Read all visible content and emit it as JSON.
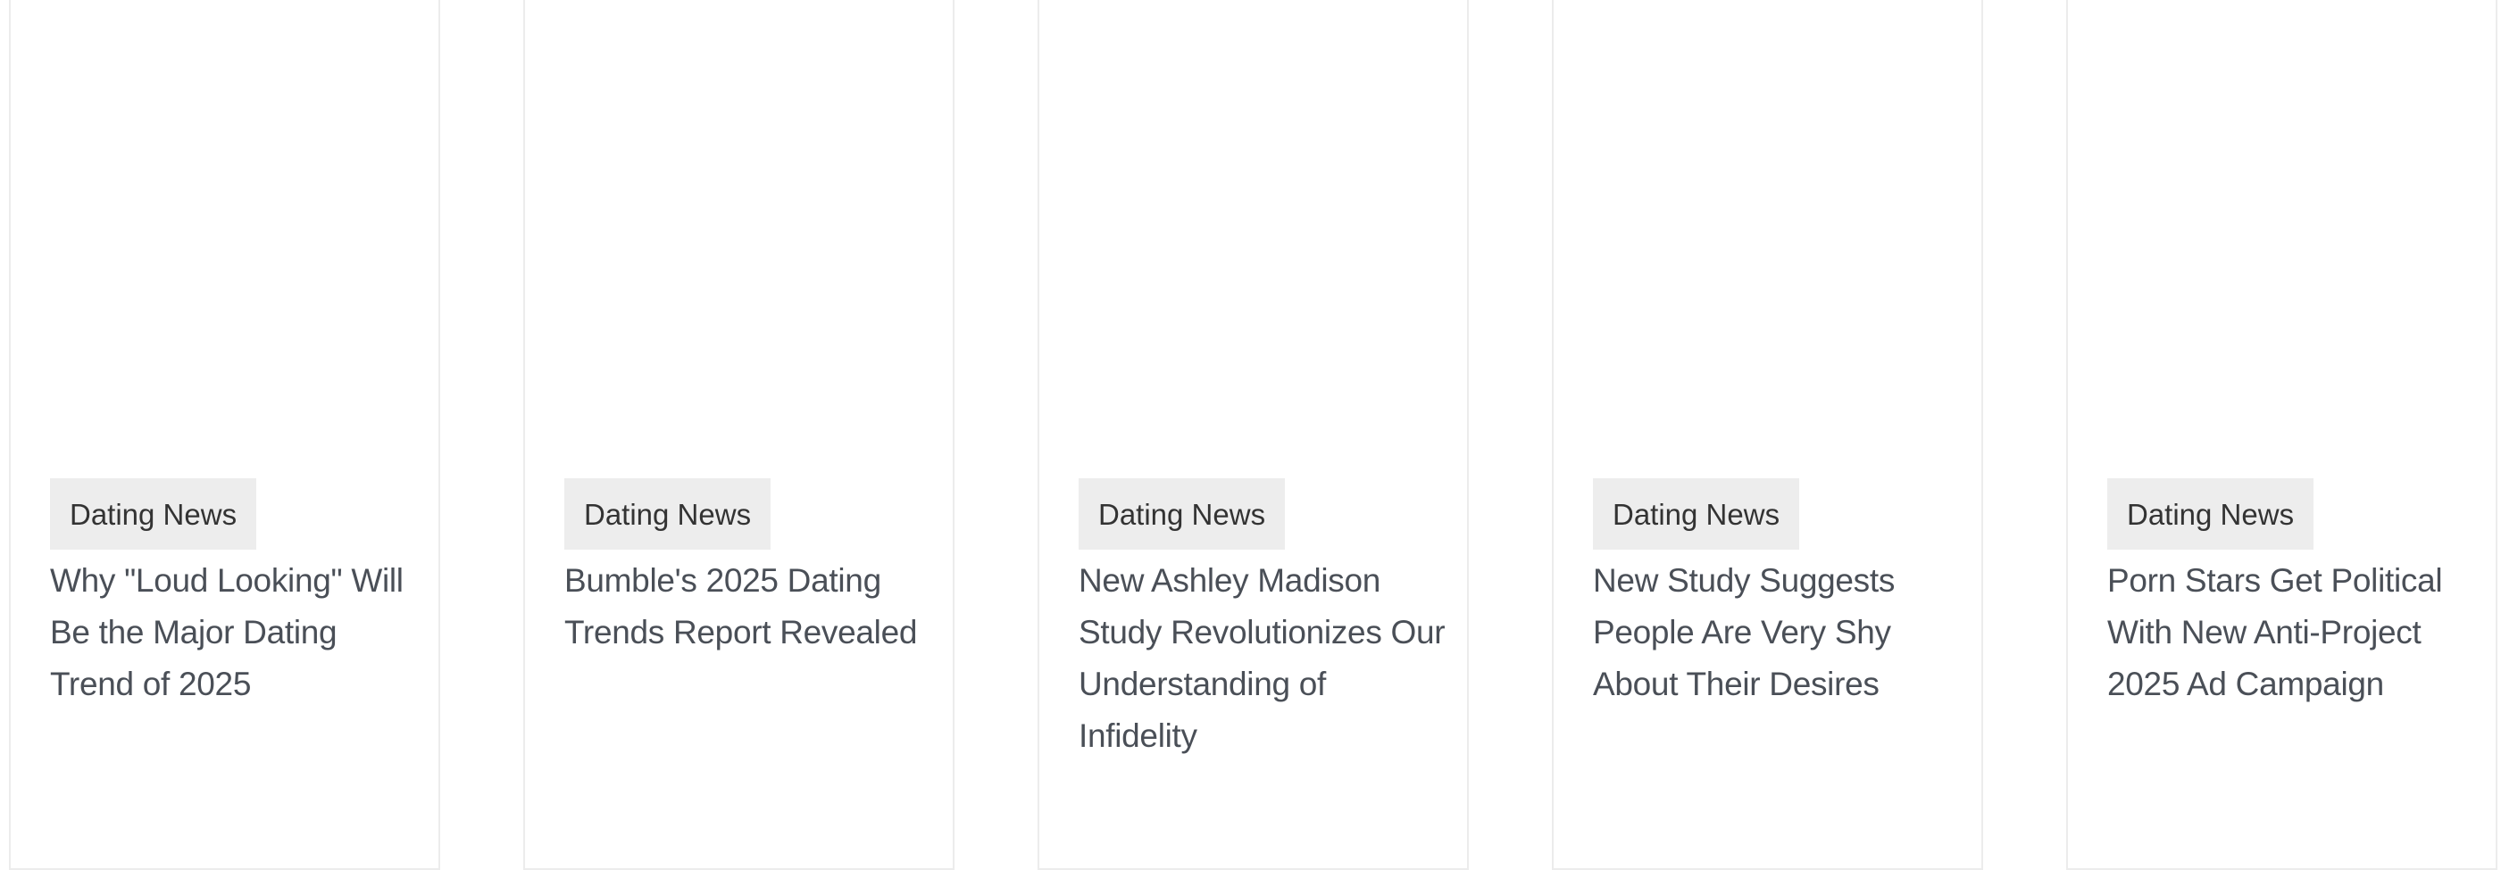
{
  "articles": [
    {
      "category": "Dating News",
      "title": "Why \"Loud Looking\" Will Be the Major Dating Trend of 2025"
    },
    {
      "category": "Dating News",
      "title": "Bumble's 2025 Dating Trends Report Revealed"
    },
    {
      "category": "Dating News",
      "title": "New Ashley Madison Study Revolutionizes Our Understanding of Infidelity"
    },
    {
      "category": "Dating News",
      "title": "New Study Suggests People Are Very Shy About Their Desires"
    },
    {
      "category": "Dating News",
      "title": "Porn Stars Get Political With New Anti-Project 2025 Ad Campaign"
    }
  ],
  "colors": {
    "border": "#ececec",
    "badge_background": "#ededed",
    "badge_text": "#333333",
    "title_text": "#4a4f57"
  }
}
